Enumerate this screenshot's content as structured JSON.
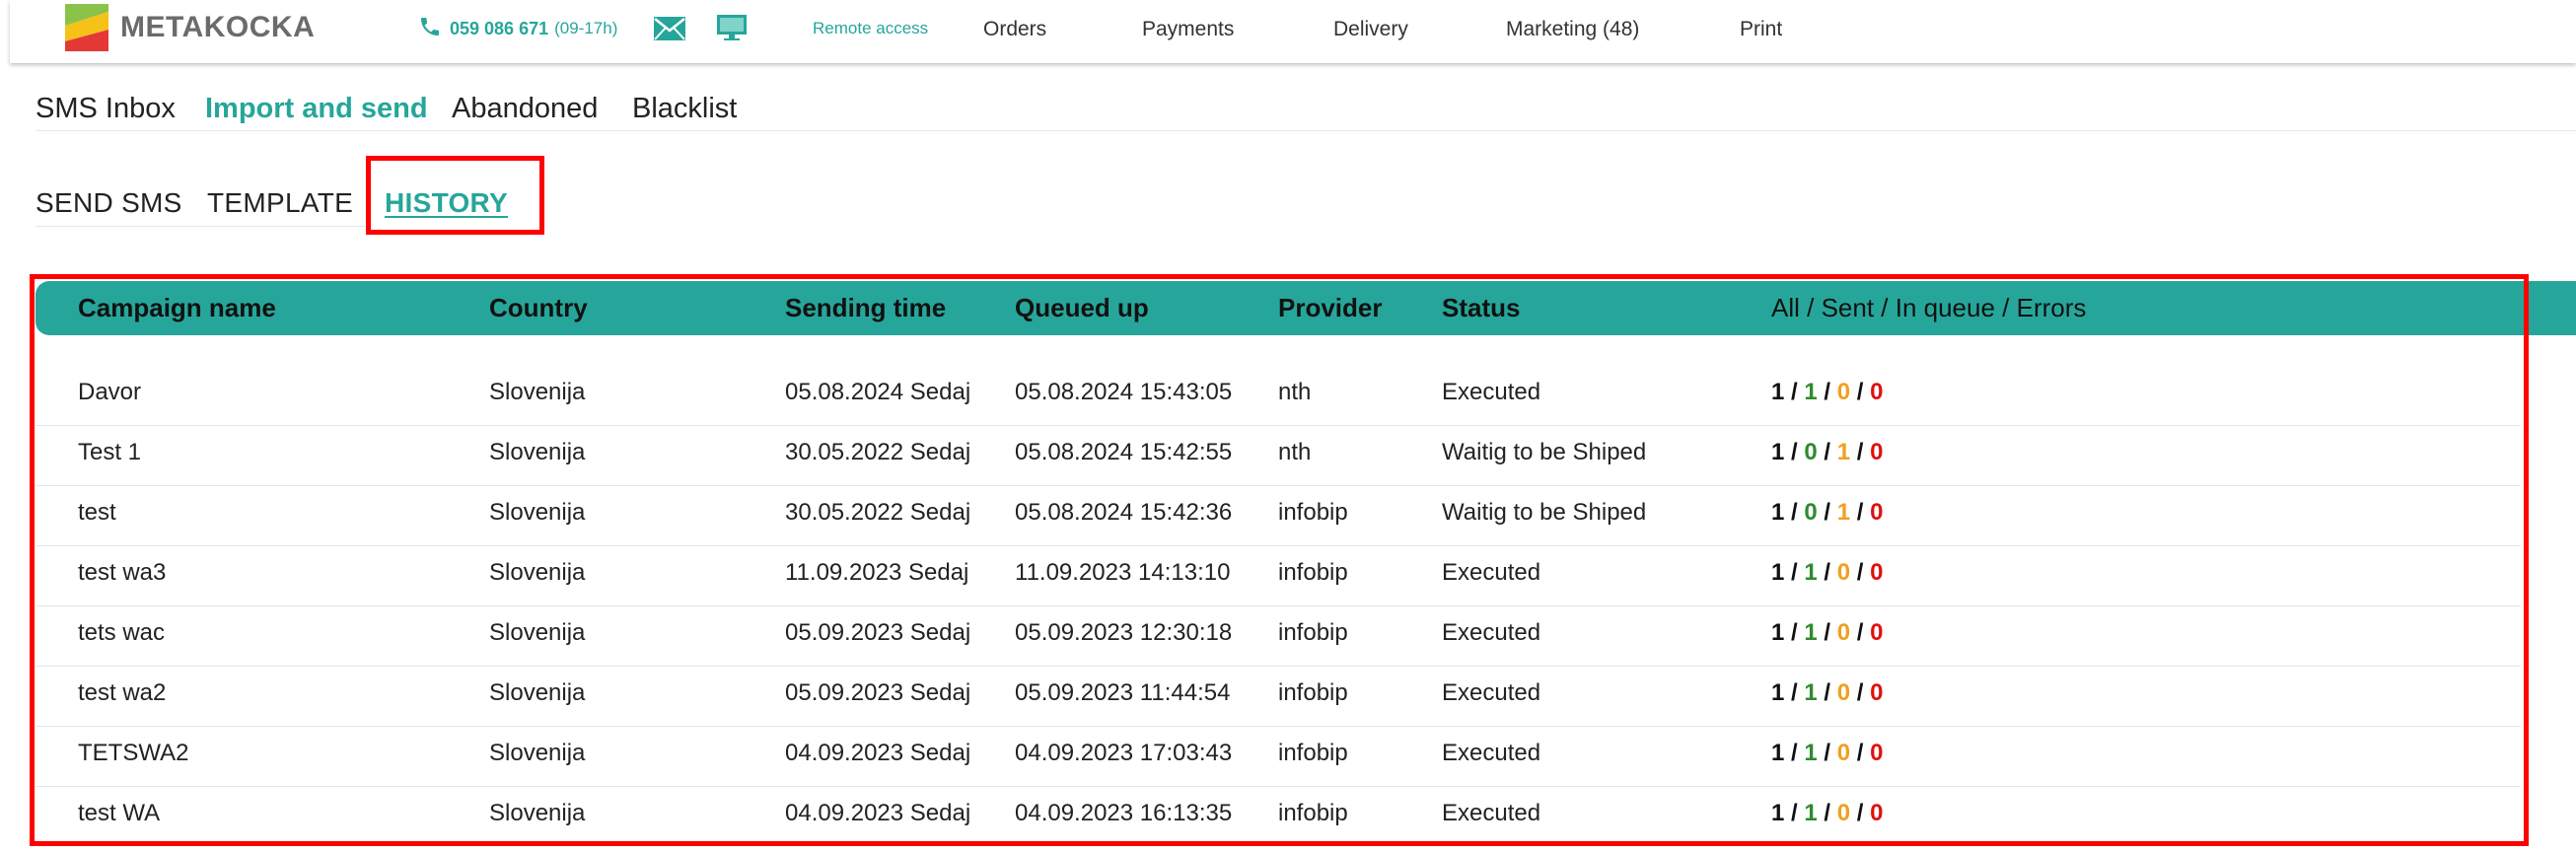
{
  "header": {
    "logo_text": "METAKOCKA",
    "phone_number": "059 086 671",
    "phone_hours": "(09-17h)",
    "remote_access": "Remote access",
    "nav": [
      "Orders",
      "Payments",
      "Delivery",
      "Marketing (48)",
      "Print"
    ]
  },
  "tabs_primary": [
    "SMS Inbox",
    "Import and send",
    "Abandoned",
    "Blacklist"
  ],
  "tabs_primary_active": "Import and send",
  "tabs_secondary": [
    "SEND SMS",
    "TEMPLATE",
    "HISTORY"
  ],
  "tabs_secondary_active": "HISTORY",
  "table": {
    "columns": [
      "Campaign name",
      "Country",
      "Sending time",
      "Queued up",
      "Provider",
      "Status",
      "All / Sent / In queue / Errors"
    ],
    "rows": [
      {
        "name": "Davor",
        "country": "Slovenija",
        "sending": "05.08.2024 Sedaj",
        "queued": "05.08.2024 15:43:05",
        "provider": "nth",
        "status": "Executed",
        "all": "1",
        "sent": "1",
        "queue": "0",
        "errors": "0"
      },
      {
        "name": "Test 1",
        "country": "Slovenija",
        "sending": "30.05.2022 Sedaj",
        "queued": "05.08.2024 15:42:55",
        "provider": "nth",
        "status": "Waitig to be Shiped",
        "all": "1",
        "sent": "0",
        "queue": "1",
        "errors": "0"
      },
      {
        "name": "test",
        "country": "Slovenija",
        "sending": "30.05.2022 Sedaj",
        "queued": "05.08.2024 15:42:36",
        "provider": "infobip",
        "status": "Waitig to be Shiped",
        "all": "1",
        "sent": "0",
        "queue": "1",
        "errors": "0"
      },
      {
        "name": "test wa3",
        "country": "Slovenija",
        "sending": "11.09.2023 Sedaj",
        "queued": "11.09.2023 14:13:10",
        "provider": "infobip",
        "status": "Executed",
        "all": "1",
        "sent": "1",
        "queue": "0",
        "errors": "0"
      },
      {
        "name": "tets wac",
        "country": "Slovenija",
        "sending": "05.09.2023 Sedaj",
        "queued": "05.09.2023 12:30:18",
        "provider": "infobip",
        "status": "Executed",
        "all": "1",
        "sent": "1",
        "queue": "0",
        "errors": "0"
      },
      {
        "name": "test wa2",
        "country": "Slovenija",
        "sending": "05.09.2023 Sedaj",
        "queued": "05.09.2023 11:44:54",
        "provider": "infobip",
        "status": "Executed",
        "all": "1",
        "sent": "1",
        "queue": "0",
        "errors": "0"
      },
      {
        "name": "TETSWA2",
        "country": "Slovenija",
        "sending": "04.09.2023 Sedaj",
        "queued": "04.09.2023 17:03:43",
        "provider": "infobip",
        "status": "Executed",
        "all": "1",
        "sent": "1",
        "queue": "0",
        "errors": "0"
      },
      {
        "name": "test WA",
        "country": "Slovenija",
        "sending": "04.09.2023 Sedaj",
        "queued": "04.09.2023 16:13:35",
        "provider": "infobip",
        "status": "Executed",
        "all": "1",
        "sent": "1",
        "queue": "0",
        "errors": "0"
      }
    ]
  },
  "colors": {
    "accent": "#26a69a",
    "sent": "#2e8b2e",
    "queue": "#f0a020",
    "errors": "#e01010",
    "highlight": "#ff0000"
  },
  "icons": [
    "logo-icon",
    "phone-icon",
    "mail-icon",
    "monitor-icon"
  ]
}
